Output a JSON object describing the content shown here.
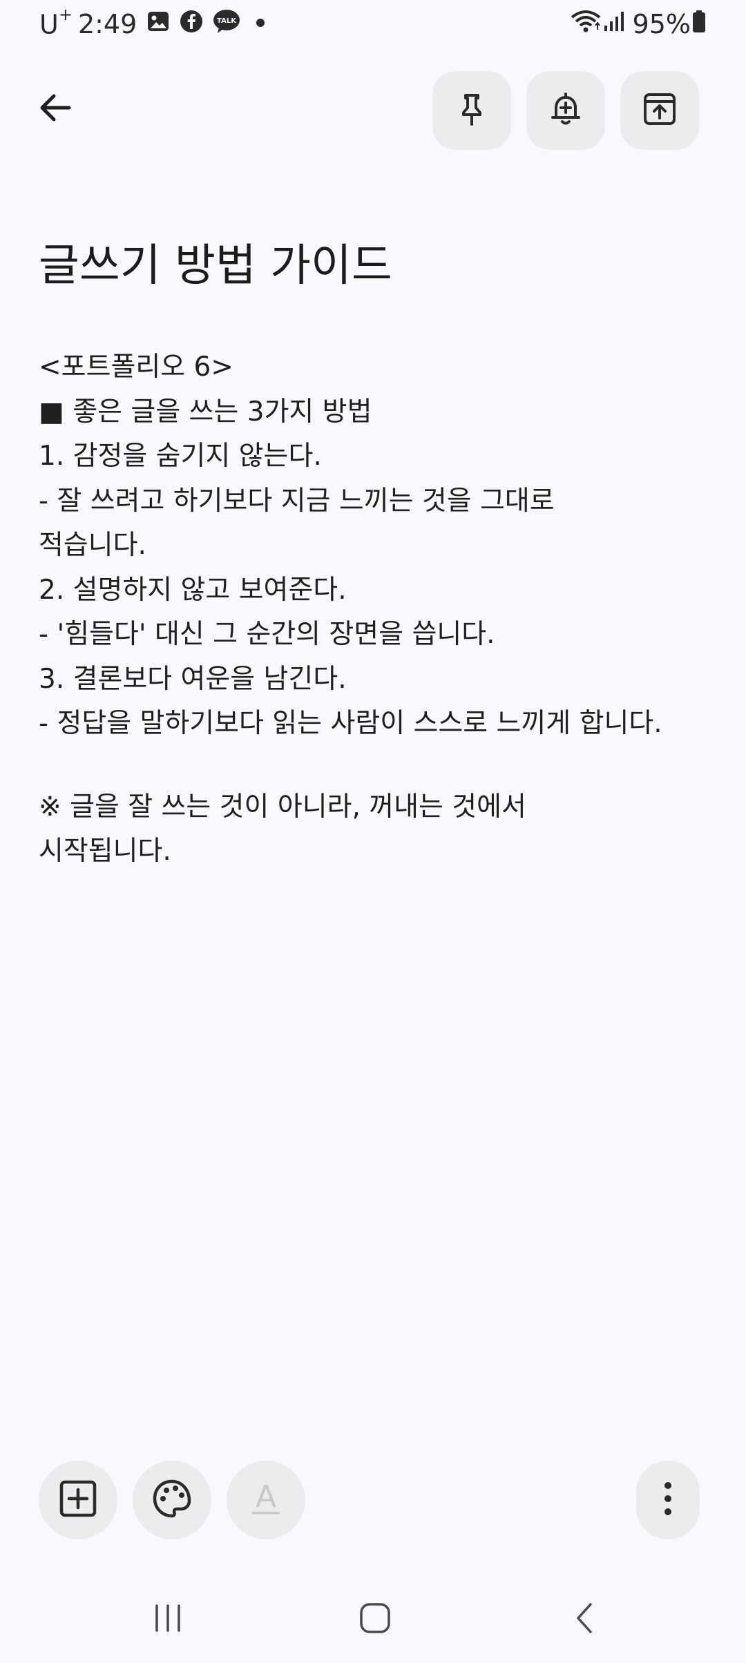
{
  "status_bar": {
    "carrier": "U",
    "carrier_sup": "+",
    "time": "2:49",
    "battery": "95%",
    "icons": [
      "gallery-icon",
      "facebook-icon",
      "kakaotalk-icon",
      "dot-icon",
      "wifi-icon",
      "signal-icon",
      "battery-icon"
    ],
    "talk_label": "TALK"
  },
  "toolbar": {
    "back_icon": "arrow-left-icon",
    "actions": [
      "pin-icon",
      "reminder-bell-icon",
      "archive-icon"
    ]
  },
  "note": {
    "title": "글쓰기 방법 가이드",
    "lines": [
      "<포트폴리오 6>",
      "■ 좋은 글을 쓰는 3가지 방법",
      "1. 감정을 숨기지 않는다.",
      "- 잘 쓰려고 하기보다 지금 느끼는 것을 그대로",
      "적습니다.",
      "2. 설명하지 않고 보여준다.",
      "- '힘들다' 대신 그 순간의 장면을 씁니다.",
      "3. 결론보다 여운을 남긴다.",
      "- 정답을 말하기보다 읽는 사람이 스스로 느끼게 합니다."
    ],
    "footer_lines": [
      "※ 글을 잘 쓰는 것이 아니라, 꺼내는 것에서",
      "시작됩니다."
    ]
  },
  "bottom_toolbar": {
    "buttons": [
      "add-content-icon",
      "palette-icon",
      "text-style-icon",
      "more-vertical-icon"
    ],
    "text_style_glyph": "A"
  },
  "colors": {
    "background": "#f9f8fd",
    "button_bg": "#ececef",
    "text": "#1f1f1f",
    "disabled": "#c8c8cc"
  }
}
